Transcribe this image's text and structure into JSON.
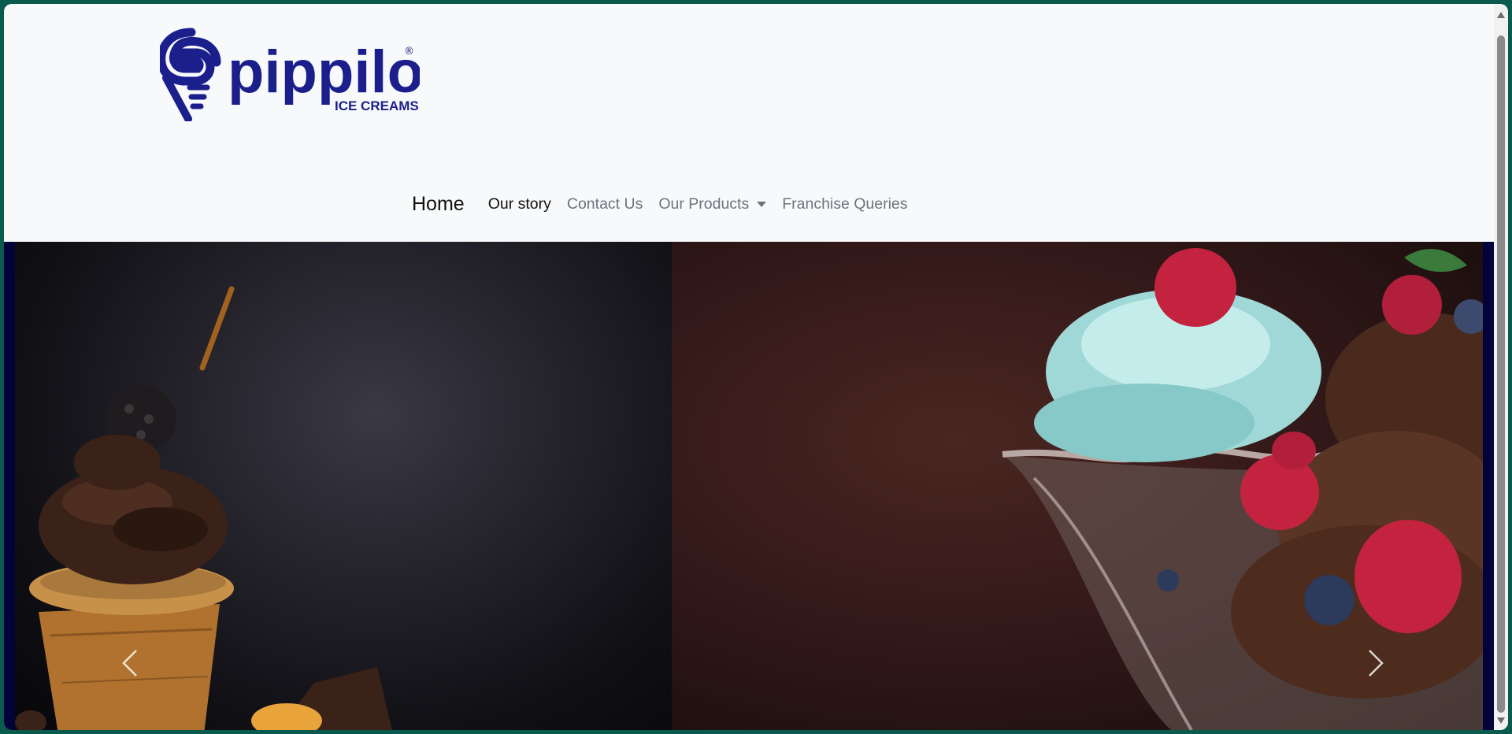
{
  "brand": {
    "name": "pippilo",
    "tagline": "ICE CREAMS",
    "registered_mark": "®",
    "color": "#1a1f8c"
  },
  "nav": {
    "home": "Home",
    "items": [
      {
        "label": "Our story",
        "active": true
      },
      {
        "label": "Contact Us",
        "active": false
      },
      {
        "label": "Our Products",
        "active": false,
        "dropdown": true
      },
      {
        "label": "Franchise Queries",
        "active": false
      }
    ]
  },
  "carousel": {
    "prev_icon": "chevron-left-icon",
    "next_icon": "chevron-right-icon",
    "slides": [
      {
        "name": "chocolate-ice-cream-cone"
      },
      {
        "name": "sundae-with-raspberries"
      }
    ]
  },
  "colors": {
    "accent": "#1a1f8c",
    "nav_active": "#111111",
    "nav_muted": "#6c757d",
    "carousel_bg": "#03033a"
  }
}
